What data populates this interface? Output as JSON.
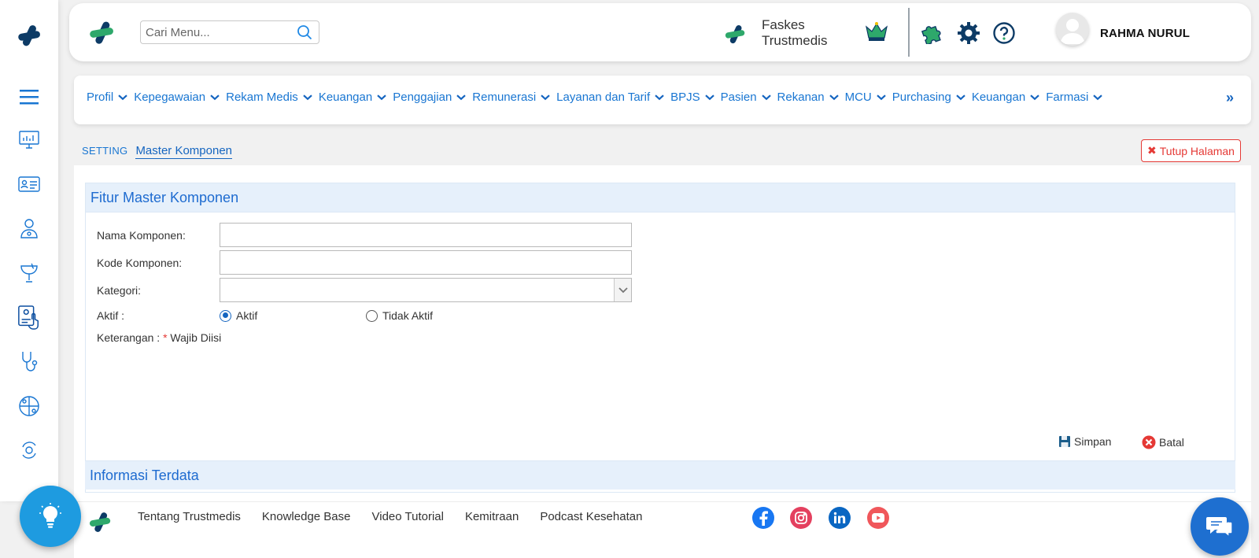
{
  "search": {
    "placeholder": "Cari Menu..."
  },
  "faskes": {
    "name": "Faskes Trustmedis"
  },
  "user": {
    "name": "RAHMA NURUL"
  },
  "nav": {
    "items": [
      {
        "label": "Profil"
      },
      {
        "label": "Kepegawaian"
      },
      {
        "label": "Rekam Medis"
      },
      {
        "label": "Keuangan"
      },
      {
        "label": "Penggajian"
      },
      {
        "label": "Remunerasi"
      },
      {
        "label": "Layanan dan Tarif"
      },
      {
        "label": "BPJS"
      },
      {
        "label": "Pasien"
      },
      {
        "label": "Rekanan"
      },
      {
        "label": "MCU"
      },
      {
        "label": "Purchasing"
      },
      {
        "label": "Keuangan"
      },
      {
        "label": "Farmasi"
      }
    ],
    "more": "»"
  },
  "breadcrumb": {
    "section": "SETTING",
    "current": "Master Komponen"
  },
  "close_page": "Tutup Halaman",
  "form": {
    "title": "Fitur Master Komponen",
    "nama_label": "Nama Komponen:",
    "nama_value": "",
    "kode_label": "Kode Komponen:",
    "kode_value": "",
    "kategori_label": "Kategori:",
    "kategori_value": "",
    "aktif_label": "Aktif :",
    "opt_aktif": "Aktif",
    "opt_tidak_aktif": "Tidak Aktif",
    "selected": "Aktif",
    "keterangan_label": "Keterangan : ",
    "required_mark": "*",
    "required_text": " Wajib Diisi",
    "save": "Simpan",
    "cancel": "Batal"
  },
  "info": {
    "title": "Informasi Terdata"
  },
  "footer": {
    "links": [
      "Tentang Trustmedis",
      "Knowledge Base",
      "Video Tutorial",
      "Kemitraan",
      "Podcast Kesehatan"
    ]
  },
  "colors": {
    "accent": "#1976d2",
    "brand_dark": "#0d3b66",
    "brand_green": "#2ea86b",
    "danger": "#e53935"
  }
}
